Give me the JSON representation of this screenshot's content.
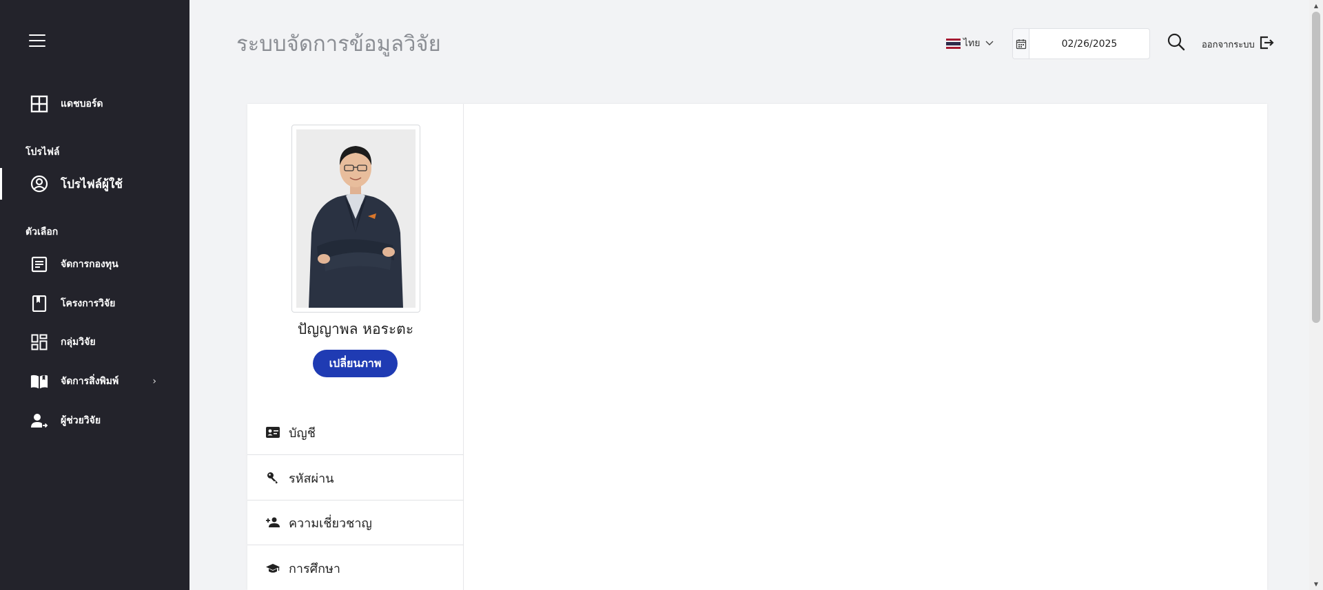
{
  "header": {
    "title": "ระบบจัดการข้อมูลวิจัย",
    "language": "ไทย",
    "date_value": "02/26/2025",
    "logout_label": "ออกจากระบบ"
  },
  "sidebar": {
    "dashboard": "แดชบอร์ด",
    "section_profile": "โปรไฟล์",
    "profile_user": "โปรไฟล์ผู้ใช้",
    "section_options": "ตัวเลือก",
    "items": [
      {
        "label": "จัดการกองทุน",
        "icon": "document-icon"
      },
      {
        "label": "โครงการวิจัย",
        "icon": "bookmark-book-icon"
      },
      {
        "label": "กลุ่มวิจัย",
        "icon": "dashboard-grid-icon"
      },
      {
        "label": "จัดการสิ่งพิมพ์",
        "icon": "open-book-icon"
      },
      {
        "label": "ผู้ช่วยวิจัย",
        "icon": "person-arrow-icon"
      }
    ]
  },
  "profile": {
    "name": "ปัญญาพล หอระตะ",
    "change_photo_label": "เปลี่ยนภาพ",
    "menu": [
      {
        "label": "บัญชี",
        "icon": "id-card-icon"
      },
      {
        "label": "รหัสผ่าน",
        "icon": "key-icon"
      },
      {
        "label": "ความเชี่ยวชาญ",
        "icon": "person-star-icon"
      },
      {
        "label": "การศึกษา",
        "icon": "graduation-cap-icon"
      }
    ]
  },
  "colors": {
    "sidebar_bg": "#23232b",
    "accent_button": "#1f3bb3",
    "page_bg": "#f2f3f5"
  }
}
